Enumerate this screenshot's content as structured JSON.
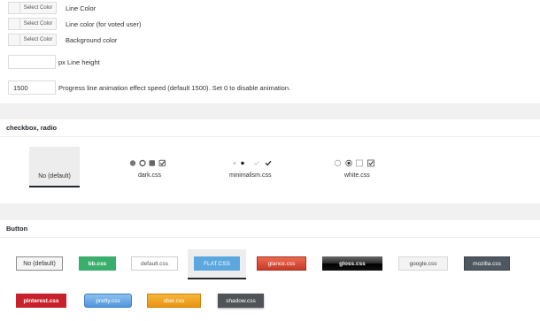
{
  "settings": {
    "select_color_label": "Select Color",
    "line_color_label": "Line Color",
    "voted_color_label": "Line color (for voted user)",
    "bg_color_label": "Background color",
    "line_height_value": "",
    "line_height_label": "px Line height",
    "anim_speed_value": "1500",
    "anim_speed_label": "Progress line animation effect speed (default 1500). Set 0 to disable animation."
  },
  "checkbox_section": {
    "title": "checkbox, radio",
    "themes": [
      {
        "label": "No (default)"
      },
      {
        "label": "dark.css"
      },
      {
        "label": "minimalism.css"
      },
      {
        "label": "white.css"
      }
    ]
  },
  "button_section": {
    "title": "Button",
    "styles": [
      {
        "label": "No (default)"
      },
      {
        "label": "bb.css"
      },
      {
        "label": "default.css"
      },
      {
        "label": "FLAT.CSS"
      },
      {
        "label": "glance.css"
      },
      {
        "label": "gloss.css"
      },
      {
        "label": "google.css"
      },
      {
        "label": "mozilla.css"
      },
      {
        "label": "pinterest.css"
      },
      {
        "label": "pretty.css"
      },
      {
        "label": "sber.css"
      },
      {
        "label": "shadow.css"
      }
    ]
  },
  "colors": {
    "accent_selected": "#23282d",
    "bb": "#3aaf6d",
    "flat": "#5ca7de",
    "glance": "#d64b35",
    "gloss": "#111111",
    "pinterest": "#c9212c",
    "pretty": "#6aa9e6",
    "sber": "#f0a21a",
    "shadow": "#505357",
    "mozilla": "#4f5760"
  }
}
